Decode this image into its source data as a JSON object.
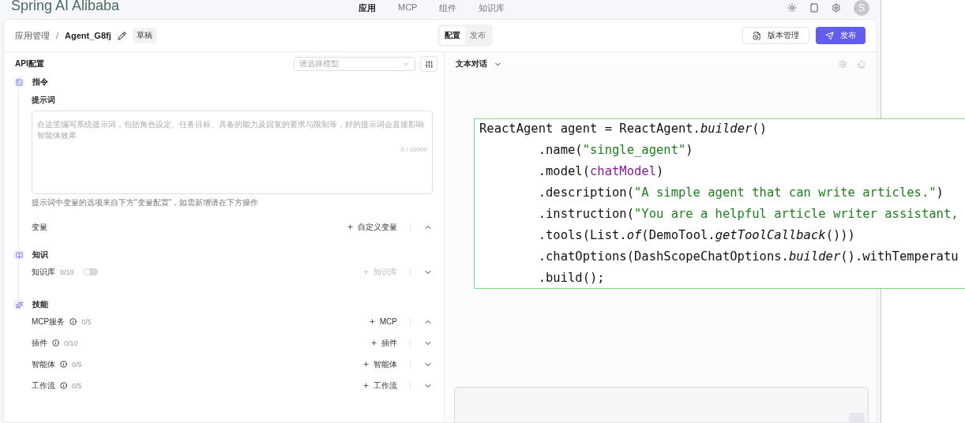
{
  "nav": {
    "logo": "Spring AI Alibaba",
    "items": [
      {
        "label": "应用",
        "selected": true
      },
      {
        "label": "MCP",
        "selected": false
      },
      {
        "label": "组件",
        "selected": false
      },
      {
        "label": "知识库",
        "selected": false
      }
    ],
    "avatar": "S"
  },
  "header": {
    "breadcrumb": [
      "应用管理",
      "Agent_G8fj"
    ],
    "separator": "/",
    "status": "草稿",
    "modes": [
      {
        "label": "配置",
        "selected": true
      },
      {
        "label": "发布",
        "selected": false
      }
    ],
    "version_button": "版本管理",
    "publish_button": "发布"
  },
  "config": {
    "title": "API配置",
    "model_placeholder": "请选择模型",
    "instruction": {
      "title": "指令",
      "prompt_label": "提示词",
      "placeholder": "在这里编写系统提示词，包括角色设定、任务目标、具备的能力及回复的要求与限制等，好的提示词会直接影响智能体效果",
      "counter": "0 / 10000",
      "hint": "提示词中变量的选项来自下方\"变量配置\"，如需新增请在下方操作",
      "variables": {
        "label": "变量",
        "add": "自定义变量",
        "expanded": true
      }
    },
    "knowledge": {
      "title": "知识",
      "rows": [
        {
          "label": "知识库",
          "count": "0/10",
          "on": false,
          "add": "知识库",
          "disabled": true,
          "expanded": false
        }
      ]
    },
    "skills": {
      "title": "技能",
      "rows": [
        {
          "label": "MCP服务",
          "count": "0/5",
          "add": "MCP",
          "expanded": true
        },
        {
          "label": "插件",
          "count": "0/10",
          "add": "插件",
          "expanded": false
        },
        {
          "label": "智能体",
          "count": "0/5",
          "add": "智能体",
          "expanded": false
        },
        {
          "label": "工作流",
          "count": "0/5",
          "add": "工作流",
          "expanded": false
        }
      ]
    }
  },
  "chat": {
    "mode": "文本对话"
  },
  "code": [
    [
      {
        "kind": "plain",
        "text": "ReactAgent agent = ReactAgent."
      },
      {
        "kind": "italic",
        "text": "builder"
      },
      {
        "kind": "plain",
        "text": "()"
      }
    ],
    [
      {
        "kind": "plain",
        "text": "        .name("
      },
      {
        "kind": "string",
        "text": "\"single_agent\""
      },
      {
        "kind": "plain",
        "text": ")"
      }
    ],
    [
      {
        "kind": "plain",
        "text": "        .model("
      },
      {
        "kind": "var",
        "text": "chatModel"
      },
      {
        "kind": "plain",
        "text": ")"
      }
    ],
    [
      {
        "kind": "plain",
        "text": "        .description("
      },
      {
        "kind": "string",
        "text": "\"A simple agent that can write articles.\""
      },
      {
        "kind": "plain",
        "text": ")"
      }
    ],
    [
      {
        "kind": "plain",
        "text": "        .instruction("
      },
      {
        "kind": "string",
        "text": "\"You are a helpful article writer assistant,"
      }
    ],
    [
      {
        "kind": "plain",
        "text": "        .tools(List."
      },
      {
        "kind": "italic",
        "text": "of"
      },
      {
        "kind": "plain",
        "text": "(DemoTool."
      },
      {
        "kind": "italic",
        "text": "getToolCallback"
      },
      {
        "kind": "plain",
        "text": "()))"
      }
    ],
    [
      {
        "kind": "plain",
        "text": "        .chatOptions(DashScopeChatOptions."
      },
      {
        "kind": "italic",
        "text": "builder"
      },
      {
        "kind": "plain",
        "text": "().withTemperatu"
      }
    ],
    [
      {
        "kind": "plain",
        "text": "        .build();"
      }
    ]
  ]
}
